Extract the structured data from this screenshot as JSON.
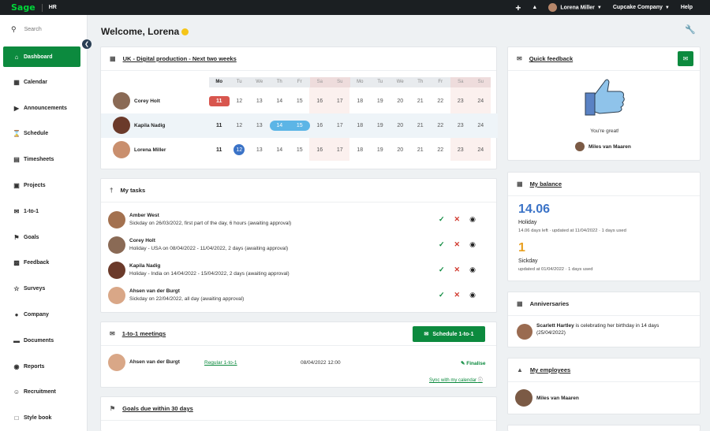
{
  "topbar": {
    "logo": "Sage",
    "app": "HR",
    "plus_icon": "+",
    "bell_icon": "🔔",
    "user": "Lorena Miller",
    "company": "Cupcake Company",
    "help": "Help"
  },
  "sidebar": {
    "search_placeholder": "Search",
    "items": [
      {
        "label": "Dashboard",
        "icon": "home-icon"
      },
      {
        "label": "Calendar",
        "icon": "calendar-icon"
      },
      {
        "label": "Announcements",
        "icon": "megaphone-icon"
      },
      {
        "label": "Schedule",
        "icon": "hourglass-icon"
      },
      {
        "label": "Timesheets",
        "icon": "timesheet-icon"
      },
      {
        "label": "Projects",
        "icon": "briefcase-icon"
      },
      {
        "label": "1-to-1",
        "icon": "chat-icon"
      },
      {
        "label": "Goals",
        "icon": "flag-icon"
      },
      {
        "label": "Feedback",
        "icon": "feedback-icon"
      },
      {
        "label": "Surveys",
        "icon": "star-icon"
      },
      {
        "label": "Company",
        "icon": "people-icon"
      },
      {
        "label": "Documents",
        "icon": "folder-icon"
      },
      {
        "label": "Reports",
        "icon": "chart-icon"
      },
      {
        "label": "Recruitment",
        "icon": "add-user-icon"
      },
      {
        "label": "Style book",
        "icon": "book-icon"
      }
    ]
  },
  "main": {
    "welcome": "Welcome, Lorena",
    "calendar": {
      "title": "UK - Digital production - Next two weeks",
      "day_names": [
        "Mo",
        "Tu",
        "We",
        "Th",
        "Fr",
        "Sa",
        "Su",
        "Mo",
        "Tu",
        "We",
        "Th",
        "Fr",
        "Sa",
        "Su"
      ],
      "dates": [
        "11",
        "12",
        "13",
        "14",
        "15",
        "16",
        "17",
        "18",
        "19",
        "20",
        "21",
        "22",
        "23",
        "24"
      ],
      "people": [
        "Corey Holt",
        "Kapila Nadig",
        "Lorena Miller"
      ]
    },
    "tasks": {
      "title": "My tasks",
      "items": [
        {
          "name": "Amber West",
          "desc": "Sickday on 26/03/2022, first part of the day, 6 hours (awaiting approval)"
        },
        {
          "name": "Corey Holt",
          "desc": "Holiday - USA on 08/04/2022 - 11/04/2022, 2 days (awaiting approval)"
        },
        {
          "name": "Kapila Nadig",
          "desc": "Holiday - India on 14/04/2022 - 15/04/2022, 2 days (awaiting approval)"
        },
        {
          "name": "Ahsen van der Burgt",
          "desc": "Sickday on 22/04/2022, all day (awaiting approval)"
        }
      ]
    },
    "one_to_one": {
      "title": "1-to-1 meetings",
      "button": "Schedule 1-to-1",
      "row": {
        "name": "Ahsen van der Burgt",
        "type": "Regular 1-to-1",
        "date": "08/04/2022 12:00",
        "finalise": "Finalise"
      },
      "sync": "Sync with my calendar"
    },
    "goals": {
      "title": "Goals due within 30 days"
    }
  },
  "right": {
    "quick_feedback": {
      "title": "Quick feedback",
      "message": "You're great!",
      "person": "Miles van Maaren"
    },
    "balance": {
      "title": "My balance",
      "holiday_value": "14.06",
      "holiday_label": "Holiday",
      "holiday_sub": "14.06 days left · updated at 11/04/2022 · 1 days used",
      "sick_value": "1",
      "sick_label": "Sickday",
      "sick_sub": "updated at 01/04/2022 · 1 days used",
      "holiday_color": "#3b73c7",
      "sick_color": "#e8a020"
    },
    "anniversaries": {
      "title": "Anniversaries",
      "name": "Scarlett Hartley",
      "text": " is celebrating her birthday in 14 days (25/04/2022)"
    },
    "employees": {
      "title": "My employees",
      "person": "Miles van Maaren"
    }
  },
  "colors": {
    "accent": "#0c8a3e",
    "topbar": "#1b1f22",
    "holiday_red": "#d8564e",
    "holiday_blue": "#5cb5e6"
  }
}
